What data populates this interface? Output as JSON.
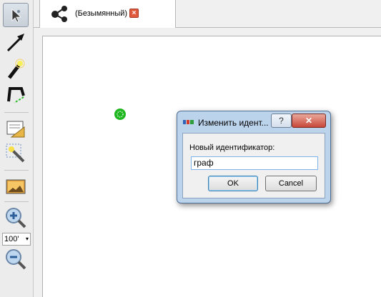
{
  "tab": {
    "label": "(Безымянный)",
    "close_glyph": "×"
  },
  "toolbar": {
    "tools": [
      "pointer-tool-icon",
      "add-edge-arrow-icon",
      "magic-wand-icon",
      "selection-path-icon",
      "document-properties-icon",
      "magic-wand-select-icon",
      "image-export-icon",
      "zoom-in-icon",
      "zoom-out-icon"
    ],
    "zoom_value": "100'",
    "zoom_arrow": "▾"
  },
  "dialog": {
    "title": "Изменить идент...",
    "help_label": "?",
    "close_label": "✕",
    "field_label": "Новый идентификатор:",
    "field_value": "граф",
    "ok_label": "OK",
    "cancel_label": "Cancel"
  },
  "colors": {
    "node": "#1fb61f",
    "accent": "#7eb4ea"
  }
}
